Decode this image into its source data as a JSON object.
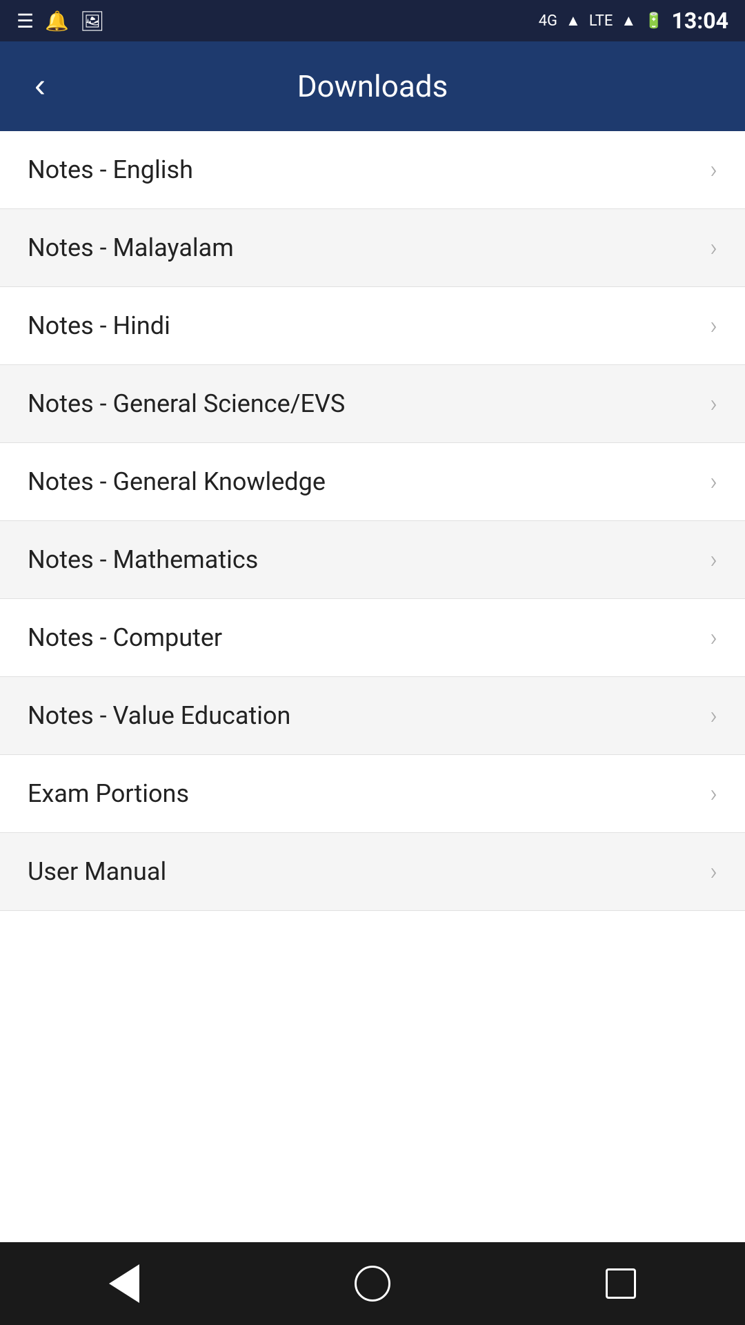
{
  "statusBar": {
    "time": "13:04",
    "icons": [
      "menu-icon",
      "bell-icon",
      "image-icon",
      "signal-4g-icon",
      "lte-icon",
      "battery-icon"
    ]
  },
  "header": {
    "title": "Downloads",
    "backLabel": "<"
  },
  "listItems": [
    {
      "id": 1,
      "label": "Notes - English"
    },
    {
      "id": 2,
      "label": "Notes - Malayalam"
    },
    {
      "id": 3,
      "label": "Notes - Hindi"
    },
    {
      "id": 4,
      "label": "Notes - General Science/EVS"
    },
    {
      "id": 5,
      "label": "Notes - General Knowledge"
    },
    {
      "id": 6,
      "label": "Notes - Mathematics"
    },
    {
      "id": 7,
      "label": "Notes - Computer"
    },
    {
      "id": 8,
      "label": "Notes - Value Education"
    },
    {
      "id": 9,
      "label": "Exam Portions"
    },
    {
      "id": 10,
      "label": "User Manual"
    }
  ],
  "bottomNav": {
    "back": "◁",
    "home": "circle",
    "recent": "square"
  }
}
